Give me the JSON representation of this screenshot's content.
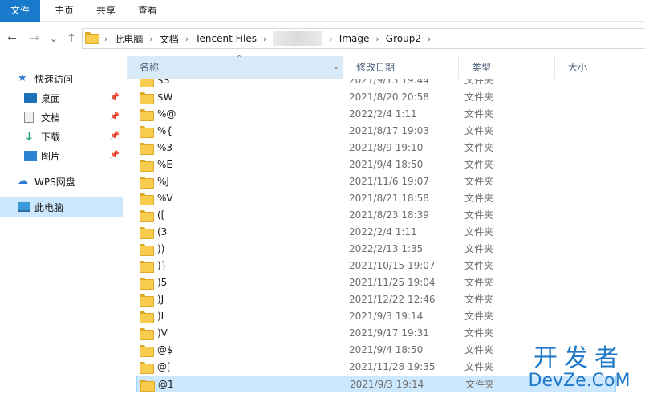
{
  "ribbon": {
    "tabs": [
      "文件",
      "主页",
      "共享",
      "查看"
    ]
  },
  "nav": {
    "back": "←",
    "forward": "→",
    "recent": "⌄",
    "up": "↑",
    "breadcrumbs": [
      "此电脑",
      "文档",
      "Tencent Files",
      "Image",
      "Group2"
    ]
  },
  "sidebar": {
    "quick_access": "快速访问",
    "items": [
      "桌面",
      "文档",
      "下载",
      "图片"
    ],
    "wps": "WPS网盘",
    "this_pc": "此电脑"
  },
  "columns": {
    "name": "名称",
    "date": "修改日期",
    "type": "类型",
    "size": "大小"
  },
  "rows": [
    {
      "name": "$S",
      "date": "2021/9/13 19:44",
      "type": "文件夹"
    },
    {
      "name": "$W",
      "date": "2021/8/20 20:58",
      "type": "文件夹"
    },
    {
      "name": "%@",
      "date": "2022/2/4 1:11",
      "type": "文件夹"
    },
    {
      "name": "%{",
      "date": "2021/8/17 19:03",
      "type": "文件夹"
    },
    {
      "name": "%3",
      "date": "2021/8/9 19:10",
      "type": "文件夹"
    },
    {
      "name": "%E",
      "date": "2021/9/4 18:50",
      "type": "文件夹"
    },
    {
      "name": "%J",
      "date": "2021/11/6 19:07",
      "type": "文件夹"
    },
    {
      "name": "%V",
      "date": "2021/8/21 18:58",
      "type": "文件夹"
    },
    {
      "name": "([",
      "date": "2021/8/23 18:39",
      "type": "文件夹"
    },
    {
      "name": "(3",
      "date": "2022/2/4 1:11",
      "type": "文件夹"
    },
    {
      "name": "))",
      "date": "2022/2/13 1:35",
      "type": "文件夹"
    },
    {
      "name": ")}",
      "date": "2021/10/15 19:07",
      "type": "文件夹"
    },
    {
      "name": ")5",
      "date": "2021/11/25 19:04",
      "type": "文件夹"
    },
    {
      "name": ")J",
      "date": "2021/12/22 12:46",
      "type": "文件夹"
    },
    {
      "name": ")L",
      "date": "2021/9/3 19:14",
      "type": "文件夹"
    },
    {
      "name": ")V",
      "date": "2021/9/17 19:31",
      "type": "文件夹"
    },
    {
      "name": "@$",
      "date": "2021/9/4 18:50",
      "type": "文件夹"
    },
    {
      "name": "@[",
      "date": "2021/11/28 19:35",
      "type": "文件夹"
    },
    {
      "name": "@1",
      "date": "2021/9/3 19:14",
      "type": "文件夹",
      "selected": true
    }
  ],
  "watermark": {
    "top": "开发者",
    "bottom": "DevZe.CoM"
  }
}
